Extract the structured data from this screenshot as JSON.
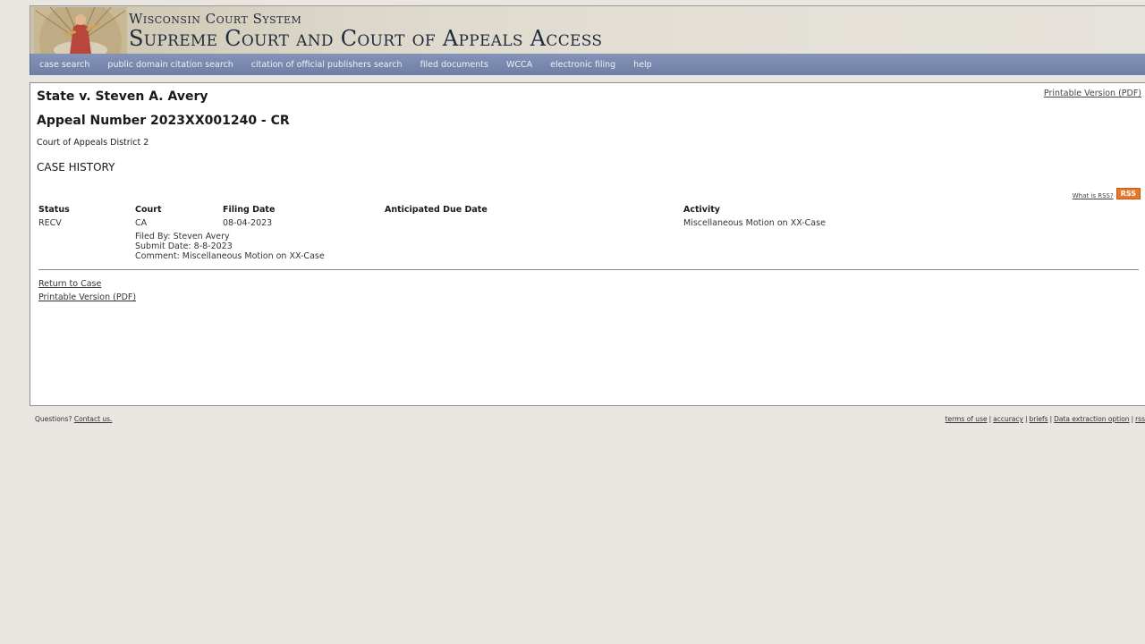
{
  "banner": {
    "line1": "Wisconsin Court System",
    "line2": "Supreme Court and Court of Appeals Access"
  },
  "nav": {
    "items": [
      {
        "label": "case search"
      },
      {
        "label": "public domain citation search"
      },
      {
        "label": "citation of official publishers search"
      },
      {
        "label": "filed documents"
      },
      {
        "label": "WCCA"
      },
      {
        "label": "electronic filing"
      },
      {
        "label": "help"
      }
    ]
  },
  "case": {
    "title": "State v. Steven A. Avery",
    "appeal_number": "Appeal Number 2023XX001240 - CR",
    "district": "Court of Appeals District 2",
    "section_heading": "CASE HISTORY",
    "print_top": "Printable Version (PDF)"
  },
  "rss": {
    "what_label": "What is RSS?",
    "badge": "RSS",
    "badge_color": "#e8762b"
  },
  "history": {
    "headers": {
      "status": "Status",
      "court": "Court",
      "filing_date": "Filing Date",
      "due_date": "Anticipated Due Date",
      "activity": "Activity"
    },
    "rows": [
      {
        "status": "RECV",
        "court": "CA",
        "filing_date": "08-04-2023",
        "due_date": "",
        "activity": "Miscellaneous Motion on XX-Case",
        "filed_by": "Filed By: Steven Avery",
        "submit_date": "Submit Date: 8-8-2023",
        "comment": "Comment: Miscellaneous Motion on XX-Case"
      }
    ]
  },
  "links": {
    "return_to_case": "Return to Case",
    "print_bottom": "Printable Version (PDF)"
  },
  "footer": {
    "questions": "Questions?",
    "contact": "Contact us.",
    "right_links": [
      "terms of use",
      "accuracy",
      "briefs",
      "Data extraction option",
      "rss"
    ]
  },
  "colors": {
    "nav_bg": "#6e7ea6",
    "page_bg": "#e9e6e2"
  }
}
